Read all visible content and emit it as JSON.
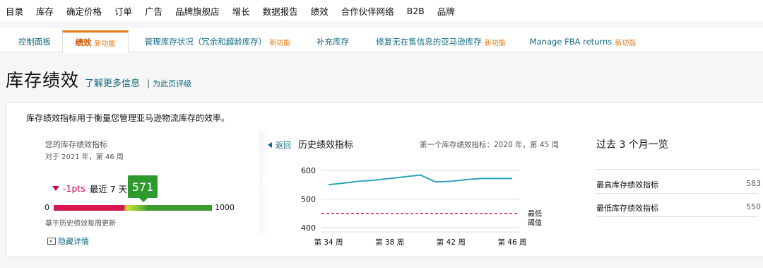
{
  "topnav": [
    "目录",
    "库存",
    "确定价格",
    "订单",
    "广告",
    "品牌旗舰店",
    "增长",
    "数据报告",
    "绩效",
    "合作伙伴网络",
    "B2B",
    "品牌"
  ],
  "tabs": [
    {
      "label": "控制面板",
      "new": ""
    },
    {
      "label": "绩效",
      "new": "新功能"
    },
    {
      "label": "管理库存状况（冗余和超龄库存）",
      "new": "新功能"
    },
    {
      "label": "补充库存",
      "new": ""
    },
    {
      "label": "修复无在售信息的亚马逊库存",
      "new": "新功能"
    },
    {
      "label": "Manage FBA returns",
      "new": "新功能"
    }
  ],
  "heading": {
    "title": "库存绩效",
    "learn_more": "了解更多信息",
    "separator": "|",
    "rate_page": "为此页评级"
  },
  "panel": {
    "description": "库存绩效指标用于衡量您管理亚马逊物流库存的效率。",
    "ipi": {
      "label": "您的库存绩效指标",
      "date": "对于 2021 年，第 46 周",
      "change": "-1pts",
      "period": "最近 7 天",
      "score": "571",
      "min": "0",
      "max": "1000",
      "note": "基于历史绩效每周更新",
      "hide_details": "隐藏详情"
    },
    "history": {
      "back": "返回",
      "title": "历史绩效指标",
      "first_ipi": "第一个库存绩效指标：2020 年，第 45 周"
    },
    "summary": {
      "title": "过去 3 个月一览",
      "rows": [
        {
          "label": "最高库存绩效指标",
          "value": "583"
        },
        {
          "label": "最低库存绩效指标",
          "value": "550"
        }
      ]
    }
  },
  "chart_data": {
    "type": "line",
    "x": [
      34,
      35,
      36,
      37,
      38,
      39,
      40,
      41,
      42,
      43,
      44,
      45,
      46
    ],
    "x_tick_labels": [
      "第 34 周",
      "第 38 周",
      "第 42 周",
      "第 46 周"
    ],
    "x_ticks": [
      34,
      38,
      42,
      46
    ],
    "series": [
      {
        "values": [
          550,
          556,
          562,
          566,
          572,
          578,
          584,
          560,
          562,
          568,
          572,
          572,
          572
        ],
        "color": "#2ba4b5"
      }
    ],
    "threshold": {
      "value": 450,
      "label": "最低阈值",
      "color": "#d6164e"
    },
    "y_ticks": [
      400,
      500,
      600
    ],
    "ylim": [
      385,
      615
    ],
    "grid": true
  }
}
